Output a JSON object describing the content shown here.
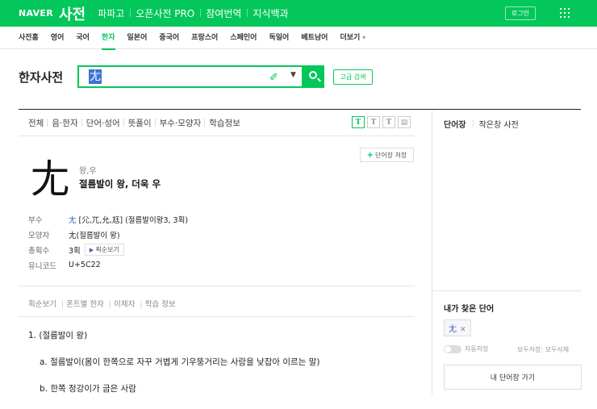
{
  "topbar": {
    "logo": "NAVER",
    "brand": "사전",
    "nav": [
      "파파고",
      "오픈사전 PRO",
      "참여번역",
      "지식백과"
    ],
    "login": "로그인",
    "colors": {
      "accent": "#03c75a"
    }
  },
  "subnav": {
    "items": [
      "사전홈",
      "영어",
      "국어",
      "한자",
      "일본어",
      "중국어",
      "프랑스어",
      "스페인어",
      "독일어",
      "베트남어",
      "더보기"
    ],
    "active_index": 3
  },
  "search": {
    "title": "한자사전",
    "value": "尢",
    "advanced_label": "고급 검색"
  },
  "tabs": [
    "전체",
    "음·한자",
    "단어·성어",
    "뜻풀이",
    "부수·모양자",
    "학습정보"
  ],
  "font_tools": [
    "T",
    "T",
    "T"
  ],
  "entry": {
    "save_label": "단어장 저장",
    "character": "尢",
    "reading": "왕,우",
    "meaning": "절름발이 왕, 더욱 우",
    "info": {
      "radical_label": "부수",
      "radical_char": "尢",
      "radical_variants": "[尣,兀,允,尪]",
      "radical_desc": "(절름발이왕3, 3획)",
      "shape_label": "모양자",
      "shape_value": "尢(절름발이 왕)",
      "strokes_label": "총획수",
      "strokes_value": "3획",
      "stroke_order_label": "획순보기",
      "unicode_label": "유니코드",
      "unicode_value": "U+5C22"
    },
    "subtabs": [
      "획순보기",
      "폰트별 한자",
      "이체자",
      "학습 정보"
    ],
    "definitions": {
      "d1": "1.  (절름발이 왕)",
      "d1a": "a.  절름발이(몸이 한쪽으로 자꾸 거볍게 기우뚱거리는 사람을 낮잡아 이르는 말)",
      "d1b": "b.  한쪽 정강이가 굽은 사람"
    }
  },
  "sidebar": {
    "tabs": [
      "단어장",
      "작은창 사전"
    ],
    "found_title": "내가 찾은 단어",
    "chip": "尢",
    "auto_save": "자동저장",
    "save_all": "모두저장",
    "delete_all": "모두삭제",
    "my_book": "내 단어장 가기"
  }
}
